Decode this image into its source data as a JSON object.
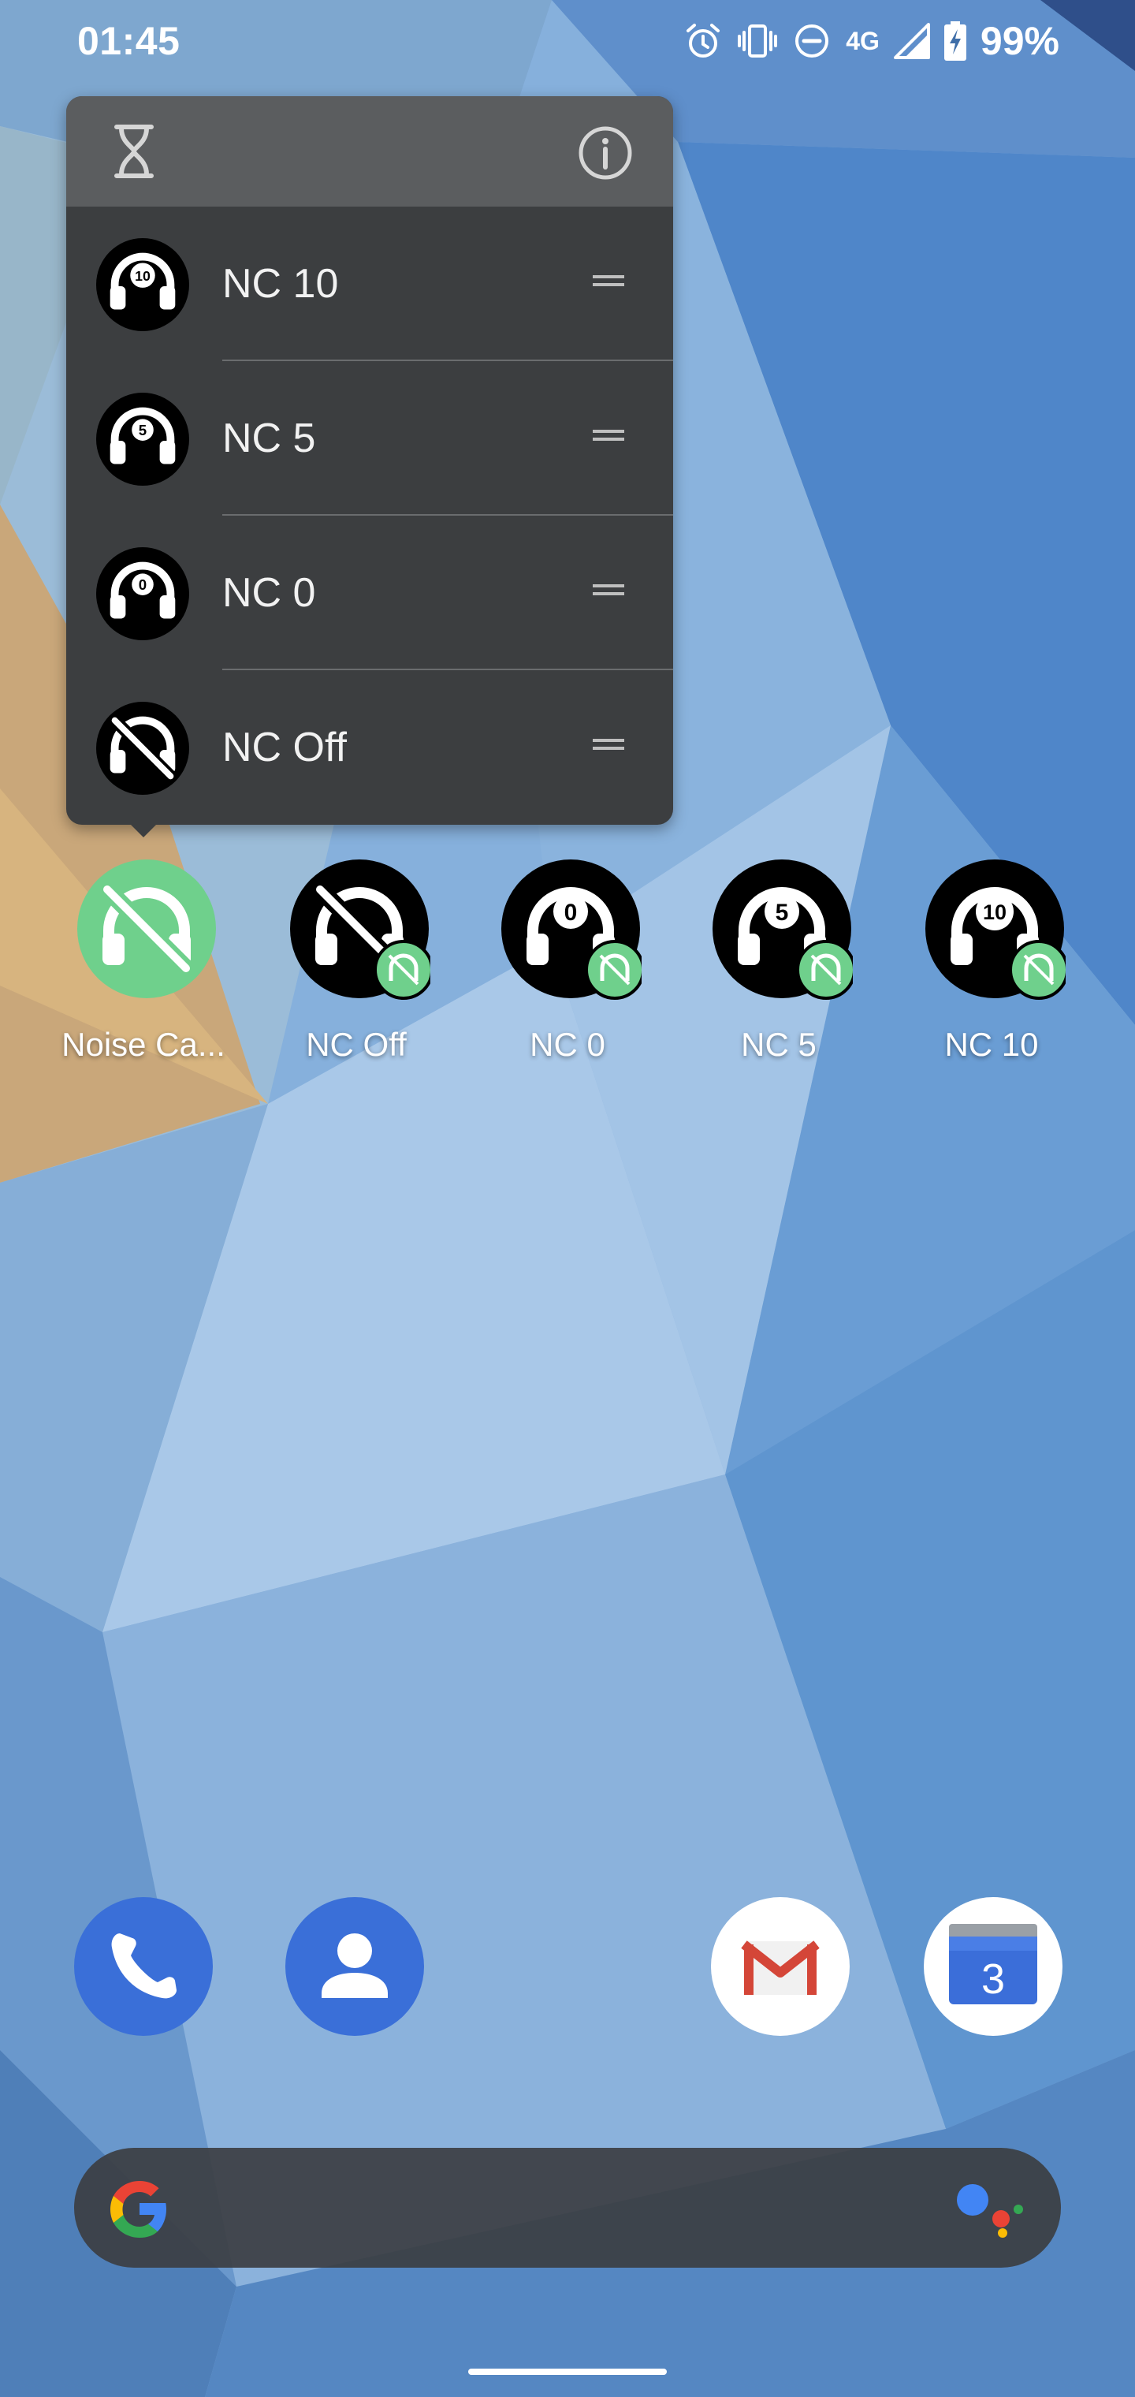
{
  "status_bar": {
    "time": "01:45",
    "network": "4G",
    "battery": "99%",
    "icons": [
      "alarm-icon",
      "vibrate-icon",
      "do-not-disturb-icon",
      "signal-icon",
      "battery-charging-icon"
    ]
  },
  "popup_menu": {
    "header_icons": [
      "hourglass-icon",
      "info-icon"
    ],
    "items": [
      {
        "label": "NC 10",
        "icon": "headphones-nc10-icon"
      },
      {
        "label": "NC 5",
        "icon": "headphones-nc5-icon"
      },
      {
        "label": "NC 0",
        "icon": "headphones-nc0-icon"
      },
      {
        "label": "NC Off",
        "icon": "headphones-off-icon"
      }
    ]
  },
  "home_shortcuts": [
    {
      "label": "Noise Ca...",
      "icon": "noise-cancelling-app-icon"
    },
    {
      "label": "NC Off",
      "icon": "headphones-off-icon"
    },
    {
      "label": "NC 0",
      "icon": "headphones-nc0-icon"
    },
    {
      "label": "NC 5",
      "icon": "headphones-nc5-icon"
    },
    {
      "label": "NC 10",
      "icon": "headphones-nc10-icon"
    }
  ],
  "dock": {
    "apps": [
      "phone-icon",
      "contacts-icon",
      "gmail-icon",
      "calendar-icon"
    ],
    "calendar_day": "3"
  },
  "search_bar": {
    "icons": [
      "google-logo-icon",
      "assistant-icon"
    ]
  },
  "colors": {
    "popup_bg": "#3c3e40",
    "popup_header": "#5b5d5f",
    "app_green": "#6fd08c",
    "dock_blue": "#3a6fd8"
  }
}
